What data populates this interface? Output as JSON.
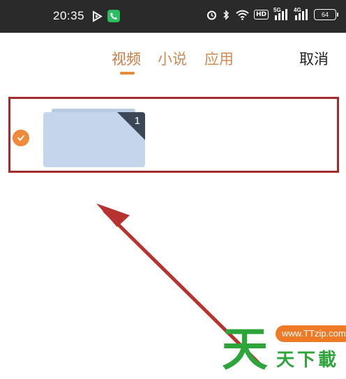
{
  "status_bar": {
    "time": "20:35",
    "battery": "64",
    "hd": "HD",
    "signal_labels": [
      "5G",
      "4G"
    ],
    "icons": [
      "media-app-icon",
      "phone-app-icon",
      "alarm-icon",
      "bluetooth-icon",
      "wifi-icon",
      "signal-5g-icon",
      "signal-4g-icon",
      "battery-icon"
    ]
  },
  "tabs": [
    {
      "label": "视频",
      "active": true
    },
    {
      "label": "小说",
      "active": false
    },
    {
      "label": "应用",
      "active": false
    }
  ],
  "header": {
    "cancel_label": "取消"
  },
  "item": {
    "count": "1",
    "selected": true
  },
  "watermark": {
    "big_char": "天",
    "url": "www.TTzip.com",
    "text": "天下載"
  },
  "colors": {
    "accent": "#e58b3a",
    "tab_text": "#d08a55",
    "highlight_border": "#a22b2b",
    "arrow": "#b8322f",
    "watermark_green": "#2da53a",
    "watermark_orange": "#ef7a25"
  }
}
